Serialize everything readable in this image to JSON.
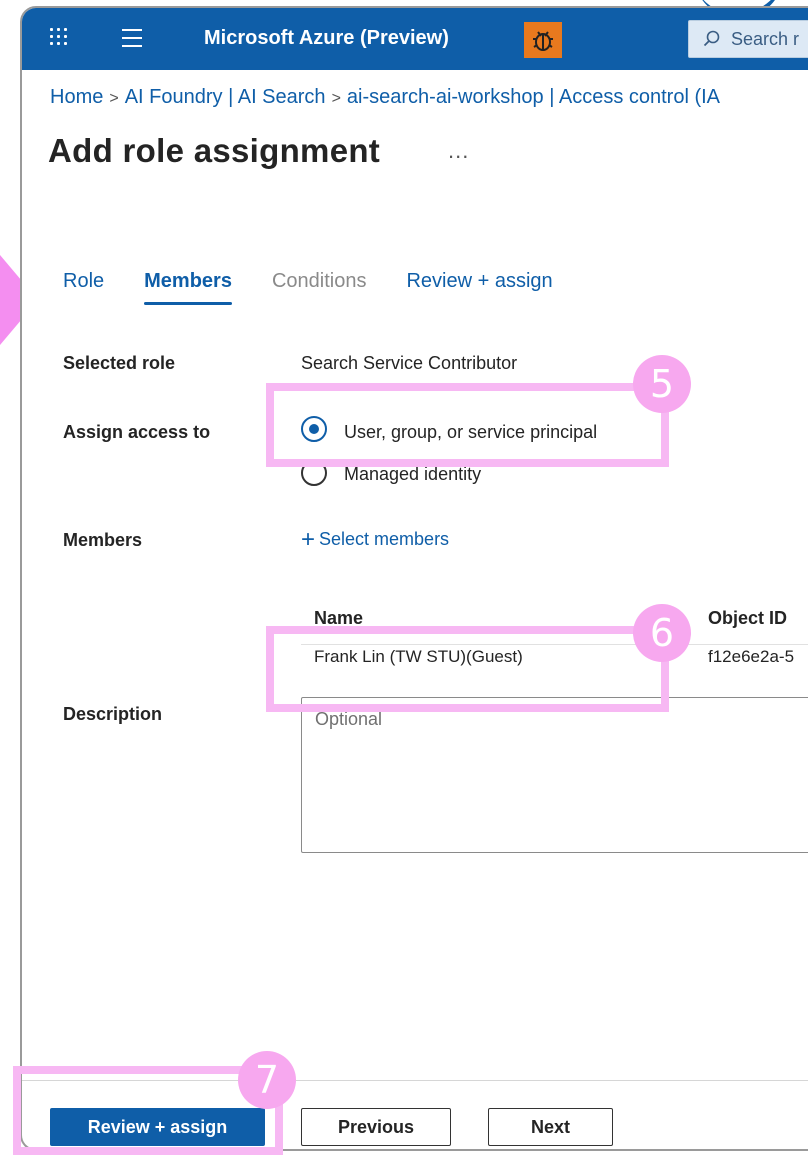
{
  "topbar": {
    "app_title": "Microsoft Azure (Preview)",
    "search_text": "Search r",
    "bg_color": "#0f5ea8"
  },
  "breadcrumb": {
    "items": [
      "Home",
      "AI Foundry | AI Search",
      "ai-search-ai-workshop | Access control (IA"
    ],
    "separator": ">"
  },
  "page": {
    "title": "Add role assignment",
    "more": "..."
  },
  "tabs": [
    {
      "label": "Role",
      "state": "link"
    },
    {
      "label": "Members",
      "state": "active"
    },
    {
      "label": "Conditions",
      "state": "disabled"
    },
    {
      "label": "Review + assign",
      "state": "link"
    }
  ],
  "form": {
    "selected_role_label": "Selected role",
    "selected_role_value": "Search Service Contributor",
    "assign_access_label": "Assign access to",
    "assign_options": [
      {
        "label": "User, group, or service principal",
        "checked": true
      },
      {
        "label": "Managed identity",
        "checked": false
      }
    ],
    "members_label": "Members",
    "select_members": "Select members",
    "members_table": {
      "headers": [
        "Name",
        "Object ID"
      ],
      "rows": [
        [
          "Frank Lin (TW STU)(Guest)",
          "f12e6e2a-5"
        ]
      ]
    },
    "description_label": "Description",
    "description_placeholder": "Optional"
  },
  "footer": {
    "review_assign": "Review + assign",
    "previous": "Previous",
    "next": "Next"
  },
  "annotations": {
    "step5": "5",
    "step6": "6",
    "step7": "7",
    "highlight_color": "#f7b8f3"
  }
}
